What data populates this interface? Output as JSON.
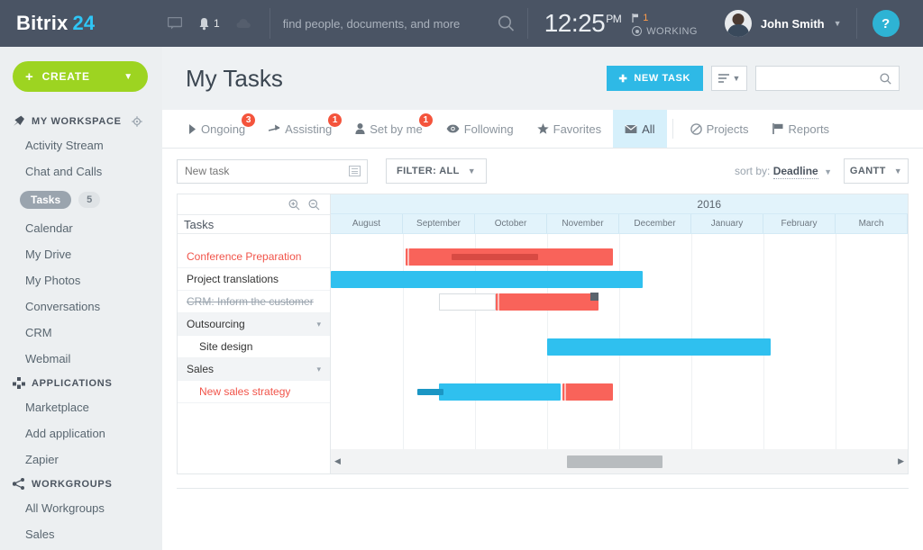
{
  "topbar": {
    "logo_primary": "Bitrix",
    "logo_secondary": "24",
    "chat_icon": "chat-bubble-icon",
    "bell_icon": "bell-icon",
    "bell_count": "1",
    "cloud_icon": "cloud-icon",
    "search_placeholder": "find people, documents, and more",
    "search_value": "",
    "search_icon": "search-icon",
    "clock_time": "12:25",
    "clock_meridiem": "PM",
    "flag_count": "1",
    "status_label": "WORKING",
    "user_name": "John Smith",
    "help_label": "?"
  },
  "sidebar": {
    "create_label": "CREATE",
    "groups": [
      {
        "icon": "pin-icon",
        "label": "MY WORKSPACE",
        "gear": "gear-icon",
        "items": [
          {
            "label": "Activity Stream",
            "active": false,
            "count": ""
          },
          {
            "label": "Chat and Calls",
            "active": false,
            "count": ""
          },
          {
            "label": "Tasks",
            "active": true,
            "count": "5"
          },
          {
            "label": "Calendar",
            "active": false,
            "count": ""
          },
          {
            "label": "My Drive",
            "active": false,
            "count": ""
          },
          {
            "label": "My Photos",
            "active": false,
            "count": ""
          },
          {
            "label": "Conversations",
            "active": false,
            "count": ""
          },
          {
            "label": "CRM",
            "active": false,
            "count": ""
          },
          {
            "label": "Webmail",
            "active": false,
            "count": ""
          }
        ]
      },
      {
        "icon": "apps-icon",
        "label": "APPLICATIONS",
        "gear": "",
        "items": [
          {
            "label": "Marketplace",
            "active": false,
            "count": ""
          },
          {
            "label": "Add application",
            "active": false,
            "count": ""
          },
          {
            "label": "Zapier",
            "active": false,
            "count": ""
          }
        ]
      },
      {
        "icon": "share-icon",
        "label": "WORKGROUPS",
        "gear": "",
        "items": [
          {
            "label": "All Workgroups",
            "active": false,
            "count": ""
          },
          {
            "label": "Sales",
            "active": false,
            "count": ""
          }
        ]
      }
    ]
  },
  "page": {
    "title": "My Tasks",
    "new_task_button": "NEW TASK",
    "view_icon": "list-view-icon",
    "view_caret": "chevron-down-icon",
    "search_placeholder": "",
    "search_value": "",
    "search_icon": "search-icon"
  },
  "tabs": [
    {
      "label": "Ongoing",
      "icon": "play-triangle-icon",
      "badge": "3",
      "selected": false
    },
    {
      "label": "Assisting",
      "icon": "arrow-right-icon",
      "badge": "1",
      "selected": false
    },
    {
      "label": "Set by me",
      "icon": "person-icon",
      "badge": "1",
      "selected": false
    },
    {
      "label": "Following",
      "icon": "eye-icon",
      "badge": "",
      "selected": false
    },
    {
      "label": "Favorites",
      "icon": "star-icon",
      "badge": "",
      "selected": false
    },
    {
      "label": "All",
      "icon": "inbox-icon",
      "badge": "",
      "selected": true
    },
    {
      "label": "Projects",
      "icon": "circle-slash-icon",
      "badge": "",
      "selected": false
    },
    {
      "label": "Reports",
      "icon": "flag-icon",
      "badge": "",
      "selected": false
    }
  ],
  "toolbar": {
    "new_task_placeholder": "New task",
    "new_task_value": "",
    "new_task_icon": "lines-icon",
    "filter_label": "FILTER: ALL",
    "filter_caret": "chevron-down-icon",
    "sort_prefix": "sort by:",
    "sort_value": "Deadline",
    "sort_caret": "chevron-down-icon",
    "gantt_label": "GANTT",
    "gantt_caret": "chevron-down-icon"
  },
  "gantt": {
    "zoom_in_icon": "zoom-in-icon",
    "zoom_out_icon": "zoom-out-icon",
    "tasks_header": "Tasks",
    "year_label": "2016",
    "year_label_left_pct": 63.5,
    "months": [
      "August",
      "September",
      "October",
      "November",
      "December",
      "January",
      "February",
      "March"
    ],
    "rows": [
      {
        "label": "Conference Preparation",
        "style": "red",
        "group": false,
        "indent": false,
        "caret": ""
      },
      {
        "label": "Project translations",
        "style": "plain",
        "group": false,
        "indent": false,
        "caret": ""
      },
      {
        "label": "CRM: Inform the customer",
        "style": "done",
        "group": false,
        "indent": false,
        "caret": ""
      },
      {
        "label": "Outsourcing",
        "style": "plain",
        "group": true,
        "indent": false,
        "caret": "▾"
      },
      {
        "label": "Site design",
        "style": "plain",
        "group": false,
        "indent": true,
        "caret": ""
      },
      {
        "label": "Sales",
        "style": "plain",
        "group": true,
        "indent": false,
        "caret": "▾"
      },
      {
        "label": "New sales strategy",
        "style": "red",
        "group": false,
        "indent": true,
        "caret": ""
      }
    ],
    "bars": [
      {
        "row": 0,
        "type": "bar",
        "color": "red",
        "left_pct": 13.0,
        "width_pct": 35.9,
        "progress_start_pct": 21.0,
        "progress_width_pct": 14.9,
        "startcap": true,
        "endflag": false
      },
      {
        "row": 1,
        "type": "bar",
        "color": "blue",
        "left_pct": 0.0,
        "width_pct": 54.0,
        "progress_start_pct": 0,
        "progress_width_pct": 0,
        "startcap": false,
        "endflag": false
      },
      {
        "row": 2,
        "type": "empty",
        "color": "",
        "left_pct": 18.7,
        "width_pct": 9.9,
        "progress_start_pct": 0,
        "progress_width_pct": 0,
        "startcap": false,
        "endflag": false
      },
      {
        "row": 2,
        "type": "bar",
        "color": "red",
        "left_pct": 28.6,
        "width_pct": 17.8,
        "progress_start_pct": 0,
        "progress_width_pct": 0,
        "startcap": true,
        "endflag": true
      },
      {
        "row": 4,
        "type": "bar",
        "color": "blue",
        "left_pct": 37.5,
        "width_pct": 38.8,
        "progress_start_pct": 0,
        "progress_width_pct": 0,
        "startcap": false,
        "endflag": false
      },
      {
        "row": 6,
        "type": "bar",
        "color": "blue",
        "left_pct": 18.7,
        "width_pct": 21.2,
        "progress_start_pct": 15.0,
        "progress_width_pct": 4.6,
        "startcap": false,
        "endflag": false
      },
      {
        "row": 6,
        "type": "bar",
        "color": "red",
        "left_pct": 40.1,
        "width_pct": 8.8,
        "progress_start_pct": 0,
        "progress_width_pct": 0,
        "startcap": true,
        "endflag": false
      }
    ],
    "scroll_left_arrow": "chevron-left-icon",
    "scroll_right_arrow": "chevron-right-icon",
    "scroll_thumb_left_pct": 41.0,
    "scroll_thumb_width_pct": 16.5
  },
  "colors": {
    "brand_blue": "#2eb9e6",
    "topbar": "#4a5464",
    "create_green": "#9dd421",
    "badge_red": "#f4543c",
    "bar_red": "#f9635a",
    "bar_blue": "#2fc0ef",
    "tab_selected": "#d6f0fb"
  }
}
